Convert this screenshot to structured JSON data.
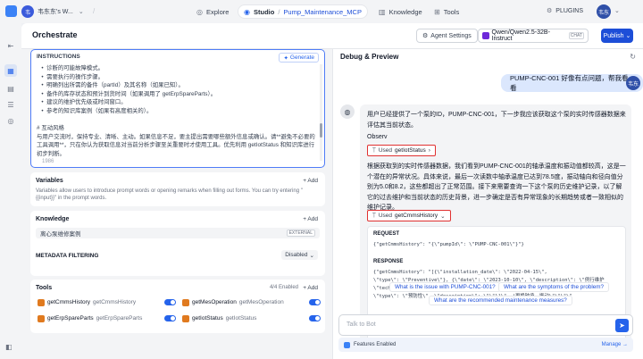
{
  "workspace": {
    "avatar": "韦",
    "name": "韦东东's W...",
    "chev": "⌄"
  },
  "nav": {
    "explore": "Explore",
    "studio": "Studio",
    "project": "Pump_Maintenance_MCP",
    "knowledge": "Knowledge",
    "tools": "Tools",
    "plugins": "PLUGINS",
    "user_avatar": "韦东"
  },
  "header": {
    "title": "Orchestrate",
    "agent_settings": "Agent Settings",
    "model": "Qwen/Qwen2.5-32B-Instruct",
    "model_badge": "CHAT",
    "publish": "Publish"
  },
  "instructions": {
    "title": "INSTRUCTIONS",
    "generate": "Generate",
    "body": "   •  诊断的可能故障模式。\n   •  需要执行的操作步骤。\n   •  明确列出所需的备件（partId）及其名称（如果已知）。\n   •  备件的库存状态和预计到货时间（如果调用了 getErpSpareParts）。\n   •  建议的维护优先级或时间窗口。\n   •  参考的知识库案例（如果有高度相关的）。\n\n# 互动风格\n与用户交流时，保持专业、清晰、主动。如果信息不足，要主提出需要哪些额外信息或确认。请**避免不必要的工具调用**，只在你认为获取信息对当前分析步骤至关重要时才使用工具。优先利用 getIotStatus 和知识库进行初步判断。",
    "count": "1986"
  },
  "variables": {
    "title": "Variables",
    "add": "+ Add",
    "desc": "Variables allow users to introduce prompt words or opening remarks when filling out forms. You can try entering \"{{input}}\" in the prompt words."
  },
  "knowledge": {
    "title": "Knowledge",
    "add": "+ Add",
    "item": "离心泵维修案例",
    "tag": "EXTERNAL"
  },
  "metadata": {
    "title": "METADATA FILTERING",
    "value": "Disabled"
  },
  "tools": {
    "title": "Tools",
    "enabled": "4/4 Enabled",
    "add": "+ Add",
    "items": [
      {
        "name": "getCmmsHistory",
        "sub": "getCmmsHistory"
      },
      {
        "name": "getMesOperation",
        "sub": "getMesOperation"
      },
      {
        "name": "getErpSpareParts",
        "sub": "getErpSpareParts"
      },
      {
        "name": "getIotStatus",
        "sub": "getIotStatus"
      }
    ]
  },
  "debug": {
    "title": "Debug & Preview",
    "user_message": "PUMP-CNC-001 好像有点问题，帮我看看",
    "user_avatar": "韦东",
    "bot_intro": "用户已经提供了一个泵的ID，PUMP-CNC-001，下一步我应该获取这个泵的实时传感器数据来评估其当前状态。",
    "observ": "Observ",
    "used1_prefix": "Used",
    "used1_tool": "getIotStatus",
    "analysis": "根据获取到的实时传感器数据，我们看到PUMP-CNC-001的轴承温度和振动值都较高，这是一个潜在的异常状况。具体来说，最后一次读数中轴承温度已达到78.5度，振动轴向和径向值分别为5.0和8.2，这些都超出了正常范围。接下来需要查询一下这个泵的历史维护记录，以了解它的过去维护和当前状态的历史背景，进一步确定是否有异常现象的长期趋势或者一致相似的维护记录。",
    "used2_prefix": "Used",
    "used2_tool": "getCmmsHistory",
    "request_label": "REQUEST",
    "request_code": "{\"getCmmsHistory\": \"{\\\"pumpId\\\": \\\"PUMP-CNC-001\\\"}\"}",
    "response_label": "RESPONSE",
    "response_code": "{\"getCmmsHistory\": \"[{\\\"installation_date\\\": \\\"2022-04-15\\\",\n\\\"type\\\": \\\"Preventive\\\"}, {\\\"date\\\": \\\"2023-10-10\\\", \\\"description\\\": \\\"例行维护\n\\\"technician_notes\\\": \\\"\\\"}, {\\\"date\\\": \\\"2024-03-22\\\", \\\"description\\\": \\\"更换\n\\\"type\\\": \\\"预防性\\\", \\\"description\\\": \\\"\\\"}]\\\"  (更换轴承，振动\\\"\\\"\\\"\\\"",
    "suggestions": [
      "What is the issue with PUMP-CNC-001?",
      "What are the symptoms of the problem?",
      "What are the recommended maintenance measures?"
    ],
    "input_placeholder": "Talk to Bot",
    "features": "Features Enabled",
    "manage": "Manage →"
  }
}
